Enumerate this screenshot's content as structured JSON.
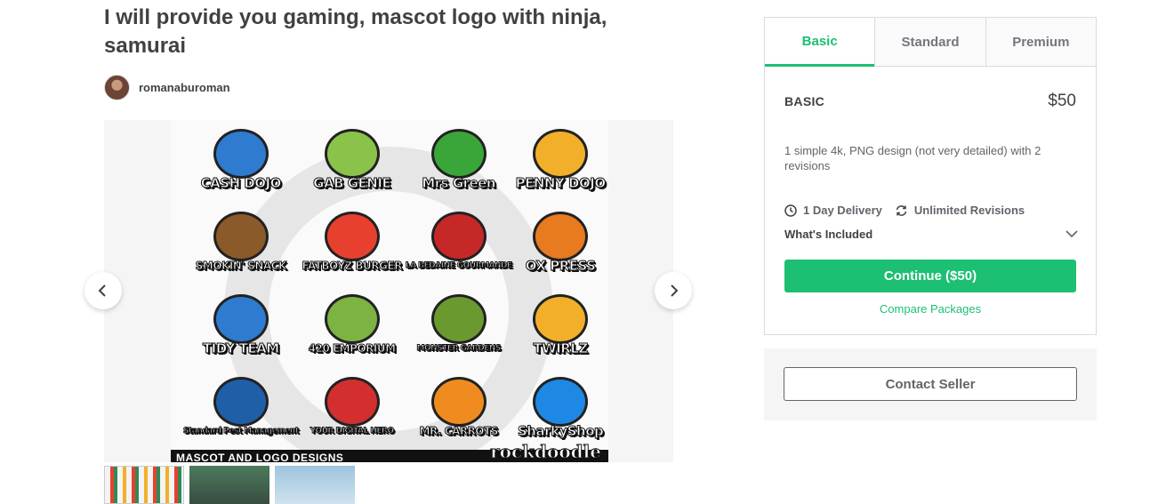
{
  "gig": {
    "title": "I will provide you gaming, mascot logo with ninja, samurai"
  },
  "seller": {
    "name": "romanaburoman"
  },
  "gallery": {
    "logos": [
      {
        "text": "CASH DOJO",
        "color": "#2e7bcf"
      },
      {
        "text": "GAB GENIE",
        "color": "#8bc34a"
      },
      {
        "text": "Mrs Green",
        "color": "#3aa63a"
      },
      {
        "text": "PENNY DOJO",
        "color": "#f2b02a"
      },
      {
        "text": "SMOKIN' SNACK",
        "color": "#8a5a2b"
      },
      {
        "text": "FATBOYZ BURGER",
        "color": "#e8402f"
      },
      {
        "text": "LA BEDAINE GOURMANDE",
        "color": "#c62828"
      },
      {
        "text": "OX PRESS",
        "color": "#e87a1f"
      },
      {
        "text": "TIDY TEAM",
        "color": "#2e7bcf"
      },
      {
        "text": "420 EMPORIUM",
        "color": "#7cb342"
      },
      {
        "text": "MONSTER GARDENS",
        "color": "#6a9a2f"
      },
      {
        "text": "TWIRLZ",
        "color": "#f2b02a"
      },
      {
        "text": "Standard Pest Management",
        "color": "#1f5fa8"
      },
      {
        "text": "YOUR DIGITAL HERO",
        "color": "#d32f2f"
      },
      {
        "text": "MR. CARROTS",
        "color": "#f08c1f"
      },
      {
        "text": "SharkyShop",
        "color": "#1e88e5"
      }
    ],
    "banner_text": "MASCOT AND LOGO DESIGNS",
    "brand_text": "rockdoodle"
  },
  "package_panel": {
    "tabs": [
      {
        "label": "Basic",
        "active": true
      },
      {
        "label": "Standard",
        "active": false
      },
      {
        "label": "Premium",
        "active": false
      }
    ],
    "name": "BASIC",
    "price": "$50",
    "description": "1 simple 4k, PNG design (not very detailed) with 2 revisions",
    "delivery": "1 Day Delivery",
    "revisions": "Unlimited Revisions",
    "whats_included": "What's Included",
    "continue_label": "Continue ($50)",
    "compare_label": "Compare Packages"
  },
  "contact": {
    "label": "Contact Seller"
  },
  "colors": {
    "accent": "#1dbf73",
    "text": "#404145",
    "muted": "#62646a"
  }
}
